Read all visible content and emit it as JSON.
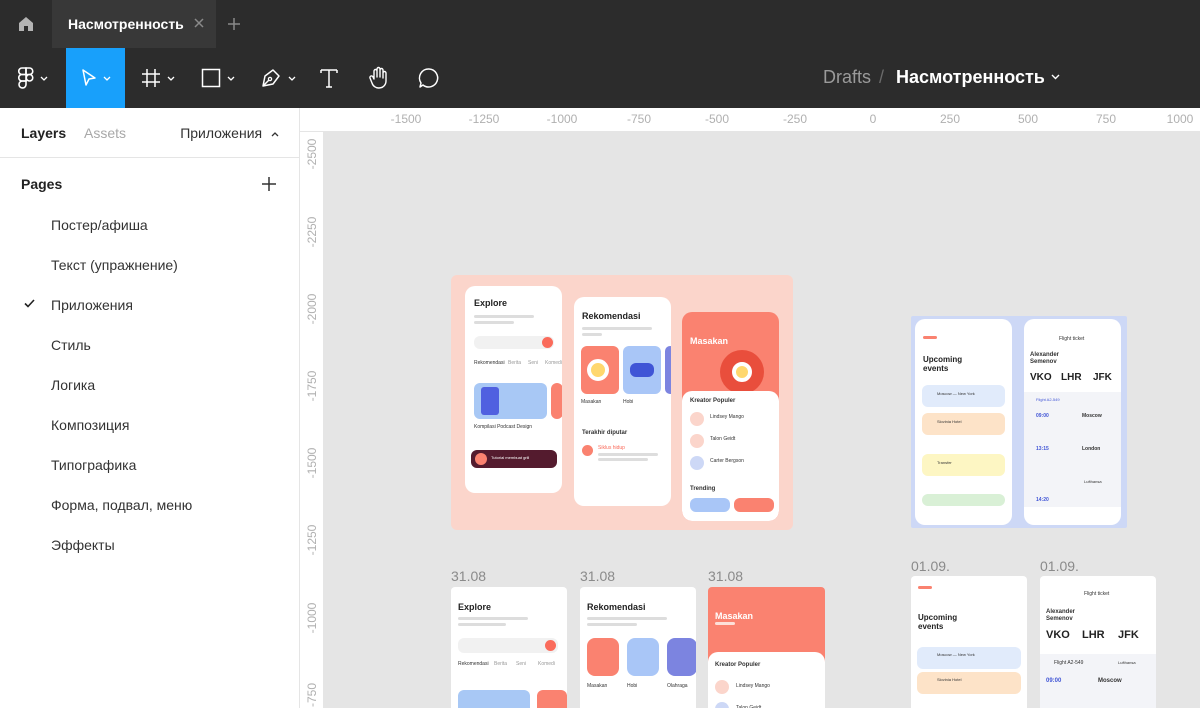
{
  "tabbar": {
    "active_tab": "Насмотренность"
  },
  "toolbar": {
    "breadcrumb_parent": "Drafts",
    "breadcrumb_sep": "/",
    "file_title": "Насмотренность"
  },
  "left_panel": {
    "tabs": [
      "Layers",
      "Assets"
    ],
    "page_selector": "Приложения",
    "pages_title": "Pages",
    "pages": [
      {
        "label": "Постер/афиша"
      },
      {
        "label": "Текст (упражнение)"
      },
      {
        "label": "Приложения",
        "current": true
      },
      {
        "label": "Стиль"
      },
      {
        "label": "Логика"
      },
      {
        "label": "Композиция"
      },
      {
        "label": "Типографика"
      },
      {
        "label": "Форма, подвал, меню"
      },
      {
        "label": "Эффекты"
      }
    ]
  },
  "rulers": {
    "top": [
      "-1500",
      "-1250",
      "-1000",
      "-750",
      "-500",
      "-250",
      "0",
      "250",
      "500",
      "750",
      "1000"
    ],
    "left": [
      "-2500",
      "-2250",
      "-2000",
      "-1750",
      "-1500",
      "-1250",
      "-1000",
      "-750"
    ]
  },
  "canvas": {
    "frame_labels": [
      "31.08",
      "31.08",
      "31.08",
      "01.09.",
      "01.09."
    ],
    "app1": {
      "explore": "Explore",
      "rekomendasi": "Rekomendasi",
      "masakan": "Masakan",
      "kreator": "Kreator Populer",
      "terakhir": "Terakhir diputar",
      "trending": "Trending",
      "kompilasi": "Kompilasi Podcast Design",
      "tab_items": [
        "Rekomendasi",
        "Berita",
        "Seni",
        "Komedi"
      ],
      "cat_items": [
        "Masakan",
        "Hobi",
        "Olahraga"
      ],
      "creators": [
        "Lindsey Mango",
        "Talon Geidt",
        "Carter Bergson"
      ],
      "tutorial": "Tutorial membuat grill",
      "siklus": "Siklus hidup"
    },
    "app2": {
      "upcoming": "Upcoming events",
      "flight_ticket": "Flight ticket",
      "passenger": "Alexander Semenov",
      "route": [
        "VKO",
        "LHR",
        "JFK"
      ],
      "events": [
        "Moscow — New York",
        "Slovinia Hotel",
        "Transfer"
      ],
      "flight_no": "Flight A2-549",
      "airline": "Lufthansa",
      "times": [
        "09:00",
        "13:15",
        "14:20"
      ],
      "cities": [
        "Moscow",
        "London"
      ]
    }
  },
  "colors": {
    "accent": "#18a0fb",
    "toolbar": "#2c2c2c",
    "coral": "#fa8270",
    "peach": "#fbd5cb",
    "lavender": "#cdd8f6"
  }
}
